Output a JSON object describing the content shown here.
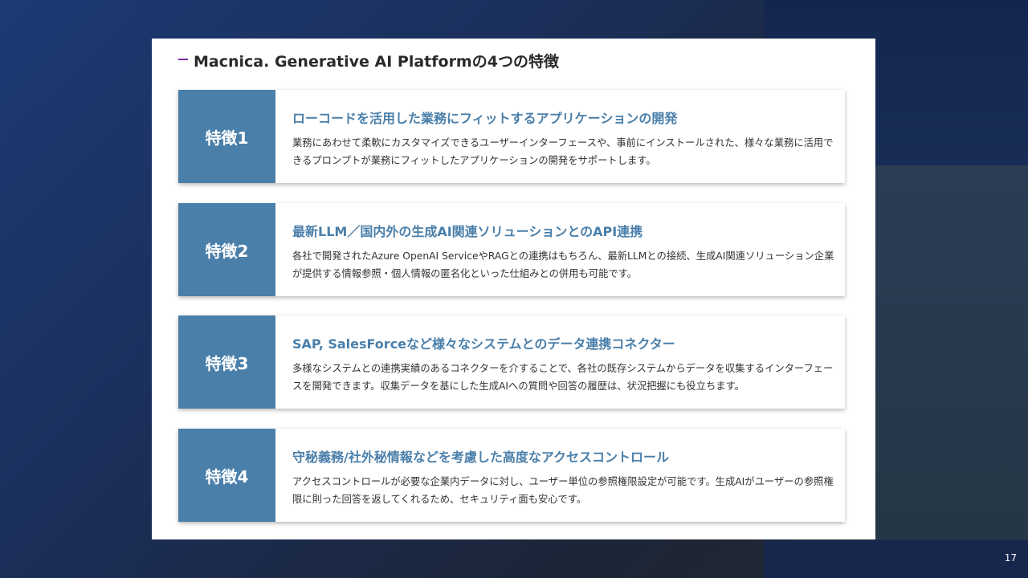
{
  "slide": {
    "title": "Macnica. Generative AI Platformの4つの特徴",
    "page_number": "17",
    "accent_color": "#4a7faa",
    "dash_color": "#7b2fa8"
  },
  "features": [
    {
      "label": "特徴1",
      "heading": "ローコードを活用した業務にフィットするアプリケーションの開発",
      "description": "業務にあわせて柔軟にカスタマイズできるユーザーインターフェースや、事前にインストールされた、様々な業務に活用できるプロンプトが業務にフィットしたアプリケーションの開発をサポートします。"
    },
    {
      "label": "特徴2",
      "heading": "最新LLM／国内外の生成AI関連ソリューションとのAPI連携",
      "description": "各社で開発されたAzure OpenAI ServiceやRAGとの連携はもちろん、最新LLMとの接続、生成AI関連ソリューション企業が提供する情報参照・個人情報の匿名化といった仕組みとの併用も可能です。"
    },
    {
      "label": "特徴3",
      "heading": "SAP, SalesForceなど様々なシステムとのデータ連携コネクター",
      "description": "多様なシステムとの連携実績のあるコネクターを介することで、各社の既存システムからデータを収集するインターフェースを開発できます。収集データを基にした生成AIへの質問や回答の履歴は、状況把握にも役立ちます。"
    },
    {
      "label": "特徴4",
      "heading": "守秘義務/社外秘情報などを考慮した高度なアクセスコントロール",
      "description": "アクセスコントロールが必要な企業内データに対し、ユーザー単位の参照権限設定が可能です。生成AIがユーザーの参照権限に則った回答を返してくれるため、セキュリティ面も安心です。"
    }
  ]
}
